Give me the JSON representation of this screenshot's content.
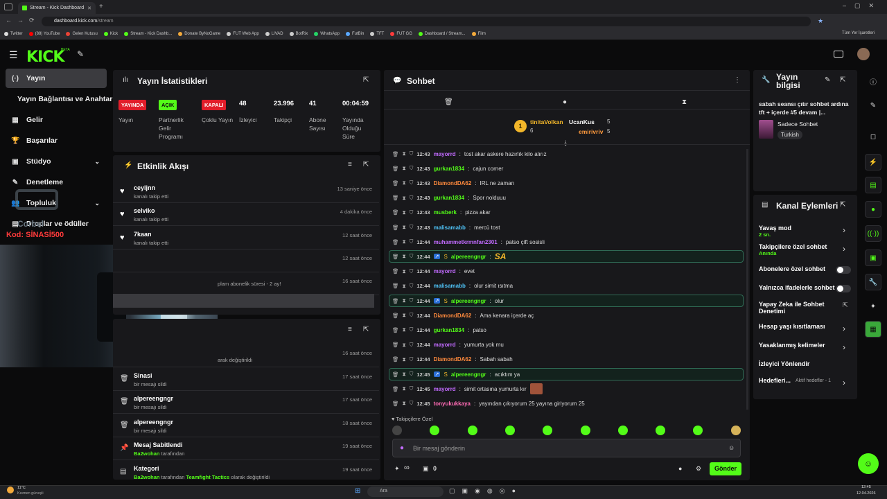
{
  "browser": {
    "tab_title": "Stream - Kick Dashboard",
    "url_host": "dashboard.kick.com",
    "url_path": "/stream",
    "bookmarks": [
      "Twitter",
      "(88) YouTube",
      "Gelen Kutusu",
      "Kick",
      "Stream - Kick Dashb...",
      "Donate ByNoGame",
      "FUT Web App",
      "LIVAD",
      "BotRix",
      "WhatsApp",
      "FutBin",
      "TFT",
      "FUT GG",
      "Dashboard / Stream...",
      "Film"
    ],
    "all_bookmarks": "Tüm Yer İşaretleri"
  },
  "kick": {
    "logo": "KICK",
    "beta": "BETA"
  },
  "sidebar": {
    "items": [
      "Yayın",
      "Yayın Bağlantısı ve Anahtarı",
      "Gelir",
      "Başarılar",
      "Stüdyo",
      "Denetleme",
      "Topluluk",
      "Droplar ve ödüller"
    ],
    "overlay_code": "Kod: SİNASİ500",
    "overlay_brand": "Corbel"
  },
  "stats": {
    "title": "Yayın İstatistikleri",
    "items": [
      {
        "badge": "YAYINDA",
        "label": "Yayın"
      },
      {
        "badge": "AÇIK",
        "label": "Partnerlik Gelir Programı"
      },
      {
        "badge": "KAPALI",
        "label": "Çoklu Yayın"
      },
      {
        "value": "48",
        "label": "İzleyici"
      },
      {
        "value": "23.996",
        "label": "Takipçi"
      },
      {
        "value": "41",
        "label": "Abone Sayısı"
      },
      {
        "value": "00:04:59",
        "label": "Yayında Olduğu Süre"
      }
    ]
  },
  "activity": {
    "title": "Etkinlik Akışı",
    "rows": [
      {
        "name": "ceyljnn",
        "sub": "kanalı takip etti",
        "time": "13 saniye önce"
      },
      {
        "name": "selviko",
        "sub": "kanalı takip etti",
        "time": "4 dakika önce"
      },
      {
        "name": "7kaan",
        "sub": "kanalı takip etti",
        "time": "12 saat önce"
      },
      {
        "name": "",
        "sub": "",
        "time": "12 saat önce"
      },
      {
        "name": "",
        "sub": "plam abonelik süresi - 2 ay!",
        "time": "16 saat önce"
      }
    ]
  },
  "modlog": {
    "rows": [
      {
        "name": "",
        "sub": "arak değiştirildi",
        "time": "16 saat önce"
      },
      {
        "name": "Sinasi",
        "sub": "bir mesajı sildi",
        "time": "17 saat önce"
      },
      {
        "name": "alpereengngr",
        "sub": "bir mesajı sildi",
        "time": "17 saat önce"
      },
      {
        "name": "alpereengngr",
        "sub": "bir mesajı sildi",
        "time": "18 saat önce"
      },
      {
        "name": "Mesaj Sabitlendi",
        "sub_user": "Ba2wohan",
        "sub": "tarafından",
        "time": "19 saat önce"
      },
      {
        "name": "Kategori",
        "sub_user": "Ba2wohan",
        "sub": "tarafından",
        "sub_tail": "Teamfight Tactics",
        "sub_end": "olarak değiştirildi",
        "time": "19 saat önce"
      }
    ]
  },
  "chat": {
    "title": "Sohbet",
    "top_users": [
      {
        "name": "tinitaVolkan",
        "count": "6",
        "rank": "1"
      },
      {
        "name": "UcanKus",
        "count": "5"
      },
      {
        "name": "emirivriv",
        "count": "5"
      }
    ],
    "messages": [
      {
        "time": "12:43",
        "user": "mayorrd",
        "color": "#c26bff",
        "text": "tost akar askere hazırlık kilo alırız"
      },
      {
        "time": "12:43",
        "user": "gurkan1834",
        "color": "#53fc18",
        "text": "cajun corner"
      },
      {
        "time": "12:43",
        "user": "DiamondDA62",
        "color": "#ff8a3d",
        "text": "IRL ne zaman"
      },
      {
        "time": "12:43",
        "user": "gurkan1834",
        "color": "#53fc18",
        "text": "Spor nolduuu"
      },
      {
        "time": "12:43",
        "user": "musberk",
        "color": "#53fc18",
        "text": "pizza akar"
      },
      {
        "time": "12:43",
        "user": "malisamabb",
        "color": "#4fc3f7",
        "text": "mercü tost"
      },
      {
        "time": "12:44",
        "user": "muhammetkrmnfan2301",
        "color": "#c26bff",
        "text": "patso çift sosisli"
      },
      {
        "time": "12:44",
        "user": "alpereengngr",
        "color": "#53fc18",
        "text": "SA",
        "hl": true
      },
      {
        "time": "12:44",
        "user": "mayorrd",
        "color": "#c26bff",
        "text": "evet"
      },
      {
        "time": "12:44",
        "user": "malisamabb",
        "color": "#4fc3f7",
        "text": "olur simit ısıtma"
      },
      {
        "time": "12:44",
        "user": "alpereengngr",
        "color": "#53fc18",
        "text": "olur",
        "hl": true
      },
      {
        "time": "12:44",
        "user": "DiamondDA62",
        "color": "#ff8a3d",
        "text": "Ama kenara içerde aç"
      },
      {
        "time": "12:44",
        "user": "gurkan1834",
        "color": "#53fc18",
        "text": "patso"
      },
      {
        "time": "12:44",
        "user": "mayorrd",
        "color": "#c26bff",
        "text": "yumurta yok mu"
      },
      {
        "time": "12:44",
        "user": "DiamondDA62",
        "color": "#ff8a3d",
        "text": "Sabah sabah"
      },
      {
        "time": "12:45",
        "user": "alpereengngr",
        "color": "#53fc18",
        "text": "acıktım ya",
        "hl": true
      },
      {
        "time": "12:45",
        "user": "mayorrd",
        "color": "#c26bff",
        "text": "simit ortasına yumurta kır"
      },
      {
        "time": "12:45",
        "user": "tonyukukkaya",
        "color": "#ff6bb5",
        "text": "yayından çıkıyorum 25 yayına giriyorum 25"
      }
    ],
    "mode_label": "Takipçilere Özel",
    "input_placeholder": "Bir mesaj gönderin",
    "send": "Gönder",
    "bottom_count": "0",
    "infinity": "∞"
  },
  "stream_info": {
    "title": "Yayın bilgisi",
    "desc": "sabah seansı çıtır sohbet ardına tft + içerde #5 devam |...",
    "category": "Sadece Sohbet",
    "tag": "Turkish"
  },
  "channel_actions": {
    "title": "Kanal Eylemleri",
    "items": [
      {
        "label": "Yavaş mod",
        "sub": "2 sn.",
        "kind": "chev"
      },
      {
        "label": "Takipçilere özel sohbet",
        "sub": "Anında",
        "kind": "chev"
      },
      {
        "label": "Abonelere özel sohbet",
        "kind": "toggle"
      },
      {
        "label": "Yalnızca ifadelerle sohbet",
        "kind": "toggle"
      },
      {
        "label": "Yapay Zeka ile Sohbet Denetimi",
        "kind": "ext"
      },
      {
        "label": "Hesap yaşı kısıtlaması",
        "kind": "chev"
      },
      {
        "label": "Yasaklanmış kelimeler",
        "kind": "chev"
      },
      {
        "label": "İzleyici Yönlendir",
        "kind": "none"
      },
      {
        "label": "Hedefleri...",
        "sub": "Aktif hedefler - 1",
        "kind": "chev"
      }
    ]
  },
  "taskbar": {
    "temp": "11°C",
    "weather": "Kısmen güneşli",
    "search": "Ara",
    "time": "12:45",
    "date": "12.04.2026"
  }
}
